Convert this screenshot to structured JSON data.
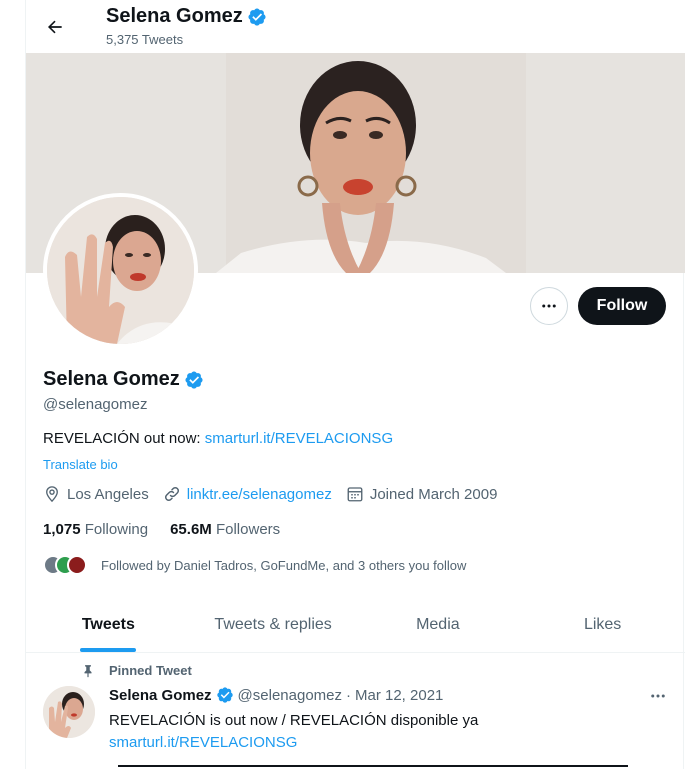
{
  "header": {
    "back_icon": "arrow-left-icon",
    "name": "Selena Gomez",
    "tweet_count": "5,375 Tweets",
    "verified_icon": "verified-badge-icon"
  },
  "profile": {
    "name": "Selena Gomez",
    "handle": "@selenagomez",
    "bio_text": "REVELACIÓN out now: ",
    "bio_link": "smarturl.it/REVELACIONSG",
    "translate": "Translate bio",
    "location": "Los Angeles",
    "website": "linktr.ee/selenagomez",
    "joined": "Joined March 2009",
    "following_count": "1,075",
    "following_label": "Following",
    "followers_count": "65.6M",
    "followers_label": "Followers",
    "followed_by": "Followed by Daniel Tadros, GoFundMe, and 3 others you follow"
  },
  "actions": {
    "more_icon": "ellipsis-icon",
    "follow_label": "Follow"
  },
  "tabs": [
    {
      "label": "Tweets",
      "active": true
    },
    {
      "label": "Tweets & replies",
      "active": false
    },
    {
      "label": "Media",
      "active": false
    },
    {
      "label": "Likes",
      "active": false
    }
  ],
  "pinned_tweet": {
    "pinned_label": "Pinned Tweet",
    "name": "Selena Gomez",
    "handle": "@selenagomez",
    "separator": "·",
    "date": "Mar 12, 2021",
    "text": "REVELACIÓN is out now / REVELACIÓN disponible ya",
    "link": "smarturl.it/REVELACIONSG"
  },
  "colors": {
    "accent": "#1d9bf0",
    "text": "#0f1419",
    "secondary": "#536471",
    "follow_bg": "#0f1419"
  }
}
